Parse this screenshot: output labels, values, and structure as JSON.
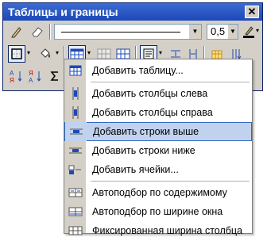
{
  "window": {
    "title": "Таблицы и границы"
  },
  "toolbar": {
    "line_weight": "0,5",
    "icons": [
      "pencil-icon",
      "eraser-icon",
      "line-style-dropdown",
      "line-weight-dropdown",
      "border-color-icon",
      "outside-border-icon",
      "shading-color-icon",
      "insert-table-icon",
      "merge-cells-icon",
      "split-cells-icon",
      "align-icon",
      "distribute-rows-icon",
      "distribute-cols-icon",
      "autoformat-icon",
      "text-direction-icon",
      "sort-asc-icon",
      "sort-desc-icon",
      "autosum-icon"
    ]
  },
  "menu": {
    "items": [
      {
        "label": "Добавить таблицу...",
        "icon": "insert-table-icon",
        "highlighted": false
      },
      {
        "label": "Добавить столбцы слева",
        "icon": "insert-columns-left-icon",
        "highlighted": false
      },
      {
        "label": "Добавить столбцы справа",
        "icon": "insert-columns-right-icon",
        "highlighted": false
      },
      {
        "label": "Добавить строки выше",
        "icon": "insert-rows-above-icon",
        "highlighted": true
      },
      {
        "label": "Добавить строки ниже",
        "icon": "insert-rows-below-icon",
        "highlighted": false
      },
      {
        "label": "Добавить ячейки...",
        "icon": "insert-cells-icon",
        "highlighted": false
      },
      {
        "label": "Автоподбор по содержимому",
        "icon": "autofit-contents-icon",
        "highlighted": false
      },
      {
        "label": "Автоподбор по ширине окна",
        "icon": "autofit-window-icon",
        "highlighted": false
      },
      {
        "label": "Фиксированная ширина столбца",
        "icon": "fixed-column-width-icon",
        "highlighted": false
      }
    ]
  },
  "colors": {
    "title_bar": "#1c48b8",
    "highlight": "#c1d2ee",
    "highlight_border": "#316ac5",
    "face": "#d4d0c8"
  }
}
